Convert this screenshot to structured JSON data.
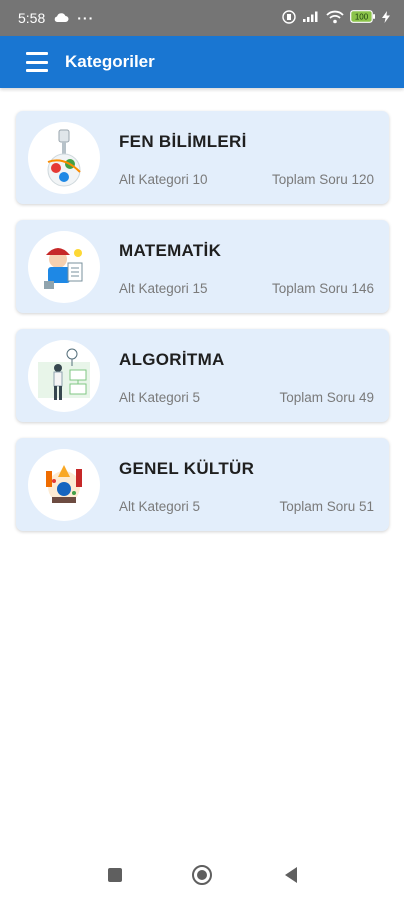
{
  "status_bar": {
    "time": "5:58",
    "extra": "···",
    "battery": "100"
  },
  "app_bar": {
    "title": "Kategoriler",
    "color": "#1976d2"
  },
  "categories": [
    {
      "title": "FEN BİLİMLERİ",
      "sub": "Alt Kategori 10",
      "total": "Toplam Soru 120",
      "icon": "science-illustration-icon"
    },
    {
      "title": "MATEMATİK",
      "sub": "Alt Kategori 15",
      "total": "Toplam Soru 146",
      "icon": "math-illustration-icon"
    },
    {
      "title": "ALGORİTMA",
      "sub": "Alt Kategori 5",
      "total": "Toplam Soru 49",
      "icon": "algorithm-illustration-icon"
    },
    {
      "title": "GENEL KÜLTÜR",
      "sub": "Alt Kategori 5",
      "total": "Toplam Soru 51",
      "icon": "culture-illustration-icon"
    }
  ],
  "navigation": {
    "recent": "recent-apps-icon",
    "home": "home-icon",
    "back": "back-icon"
  }
}
